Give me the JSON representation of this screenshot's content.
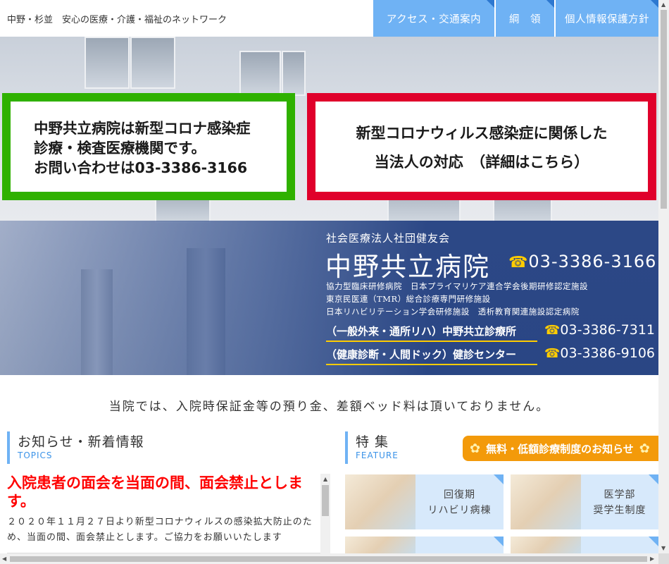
{
  "header": {
    "tagline": "中野・杉並　安心の医療・介護・福祉のネットワーク",
    "nav": [
      {
        "label": "アクセス・交通案内"
      },
      {
        "label": "綱　領"
      },
      {
        "label": "個人情報保護方針"
      }
    ]
  },
  "hero": {
    "notice_green": [
      "中野共立病院は新型コロナ感染症",
      "診療・検査医療機関です。",
      "お問い合わせは03-3386-3166"
    ],
    "notice_red": [
      "新型コロナウィルス感染症に関係した",
      "当法人の対応　（詳細はこちら）"
    ],
    "corporation": "社会医療法人社団健友会",
    "hospital_name": "中野共立病院",
    "main_phone": "03-3386-3166",
    "certifications": [
      "協力型臨床研修病院　日本プライマリケア連合学会後期研修認定施設",
      "東京民医連（TMR）総合診療専門研修施設",
      "日本リハビリテーション学会研修施設　透析教育関連施設認定病院"
    ],
    "clinics": [
      {
        "label": "（一般外来・通所リハ）中野共立診療所",
        "phone": "03-3386-7311"
      },
      {
        "label": "（健康診断・人間ドック）健診センター",
        "phone": "03-3386-9106"
      }
    ],
    "phone_icon": "☎"
  },
  "statement": "当院では、入院時保証金等の預り金、差額ベッド料は頂いておりません。",
  "topics": {
    "title": "お知らせ・新着情報",
    "subtitle": "TOPICS",
    "headline": "入院患者の面会を当面の間、面会禁止とします。",
    "body": "２０２０年１１月２７日より新型コロナウィルスの感染拡大防止のため、当面の間、面会禁止とします。ご協力をお願いいたします"
  },
  "feature": {
    "title": "特 集",
    "subtitle": "FEATURE",
    "banner": "無料・低額診療制度のお知らせ",
    "items": [
      {
        "line1": "回復期",
        "line2": "リハビリ病棟"
      },
      {
        "line1": "医学部",
        "line2": "奨学生制度"
      }
    ]
  },
  "colors": {
    "nav_blue": "#6fb2f4",
    "green_frame": "#2fb100",
    "red_frame": "#e0002b",
    "accent_yellow": "#ffcc00",
    "topic_red": "#ff0000",
    "banner_orange": "#f39a0a"
  }
}
